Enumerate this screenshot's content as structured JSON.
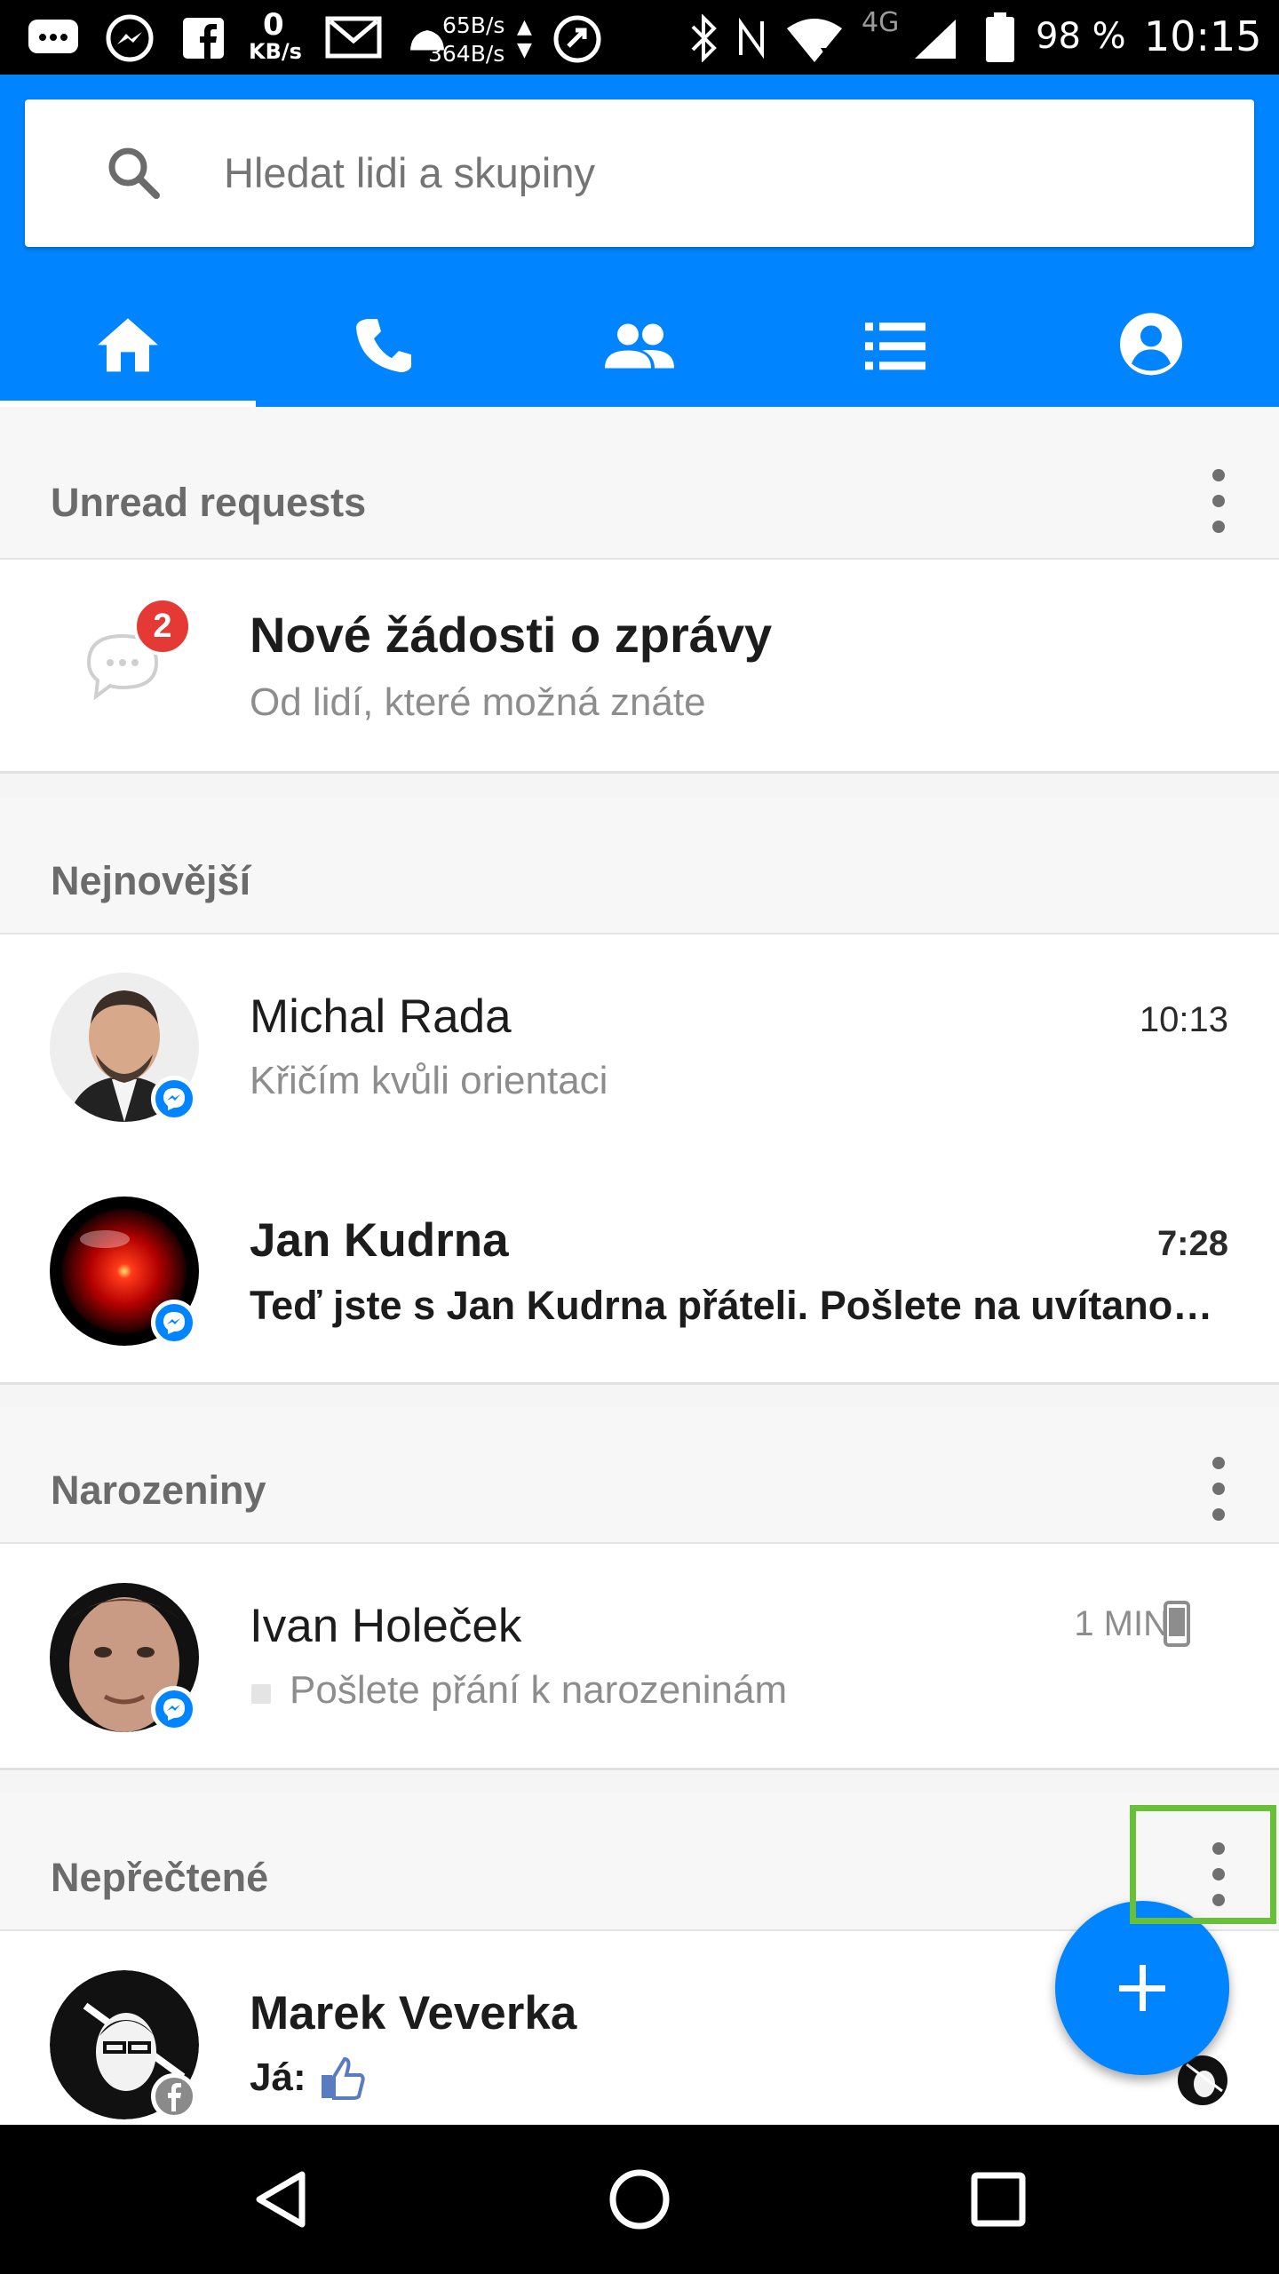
{
  "status_bar": {
    "net_speed_value": "0",
    "net_speed_unit": "KB/s",
    "traffic_up": "65B/s",
    "traffic_down": "364B/s",
    "network_type": "4G",
    "battery": "98 %",
    "time": "10:15"
  },
  "search": {
    "placeholder": "Hledat lidi a skupiny"
  },
  "tabs": [
    {
      "icon": "home-icon",
      "selected": true
    },
    {
      "icon": "phone-icon",
      "selected": false
    },
    {
      "icon": "people-icon",
      "selected": false
    },
    {
      "icon": "list-icon",
      "selected": false
    },
    {
      "icon": "profile-icon",
      "selected": false
    }
  ],
  "sections": {
    "unread_requests": {
      "title": "Unread requests",
      "request_title": "Nové žádosti o zprávy",
      "request_subtitle": "Od lidí, které možná znáte",
      "badge_count": "2"
    },
    "recent": {
      "title": "Nejnovější",
      "items": [
        {
          "name": "Michal Rada",
          "snippet": "Křičím kvůli orientaci",
          "time": "10:13",
          "unread": false
        },
        {
          "name": "Jan Kudrna",
          "snippet": "Teď jste s Jan Kudrna přáteli. Pošlete na uvítano…",
          "time": "7:28",
          "unread": true
        }
      ]
    },
    "birthdays": {
      "title": "Narozeniny",
      "items": [
        {
          "name": "Ivan Holeček",
          "snippet": "Pošlete přání k narozeninám",
          "time": "1 MIN"
        }
      ]
    },
    "unread": {
      "title": "Nepřečtené",
      "items": [
        {
          "name": "Marek Veverka",
          "snippet_prefix": "Já:"
        }
      ]
    }
  },
  "colors": {
    "brand": "#0084ff",
    "badge": "#e53935",
    "highlight": "#68c037"
  }
}
